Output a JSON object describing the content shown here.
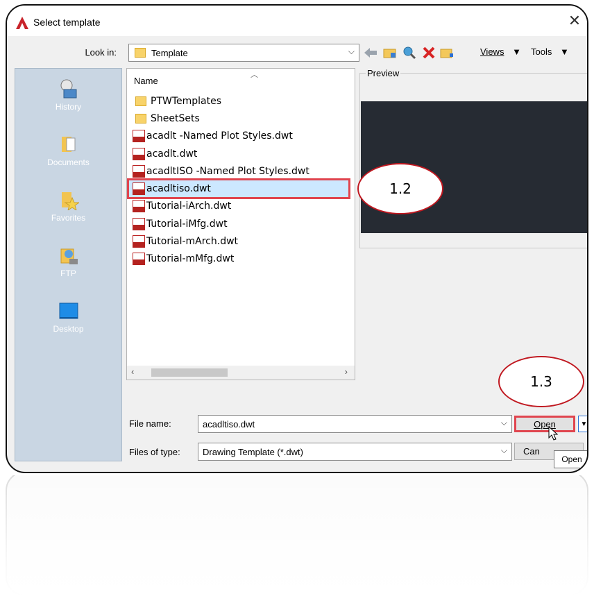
{
  "window": {
    "title": "Select template"
  },
  "toolbar": {
    "look_in_label": "Look in:",
    "look_in_value": "Template",
    "views_label": "Views",
    "tools_label": "Tools"
  },
  "places": [
    {
      "label": "History",
      "icon": "history-icon"
    },
    {
      "label": "Documents",
      "icon": "documents-icon"
    },
    {
      "label": "Favorites",
      "icon": "favorites-icon"
    },
    {
      "label": "FTP",
      "icon": "ftp-icon"
    },
    {
      "label": "Desktop",
      "icon": "desktop-icon"
    }
  ],
  "file_list": {
    "column_header": "Name",
    "items": [
      {
        "name": "PTWTemplates",
        "type": "folder"
      },
      {
        "name": "SheetSets",
        "type": "folder"
      },
      {
        "name": "acadlt -Named Plot Styles.dwt",
        "type": "dwt"
      },
      {
        "name": "acadlt.dwt",
        "type": "dwt"
      },
      {
        "name": "acadltISO -Named Plot Styles.dwt",
        "type": "dwt"
      },
      {
        "name": "acadltiso.dwt",
        "type": "dwt",
        "selected": true
      },
      {
        "name": "Tutorial-iArch.dwt",
        "type": "dwt"
      },
      {
        "name": "Tutorial-iMfg.dwt",
        "type": "dwt"
      },
      {
        "name": "Tutorial-mArch.dwt",
        "type": "dwt"
      },
      {
        "name": "Tutorial-mMfg.dwt",
        "type": "dwt"
      }
    ]
  },
  "preview": {
    "label": "Preview"
  },
  "form": {
    "file_name_label": "File name:",
    "file_name_value": "acadltiso.dwt",
    "files_of_type_label": "Files of type:",
    "files_of_type_value": "Drawing Template (*.dwt)",
    "open_label": "Open",
    "cancel_label": "Can",
    "tooltip": "Open"
  },
  "callouts": {
    "step_a": "1.2",
    "step_b": "1.3"
  },
  "colors": {
    "highlight": "#e0454f",
    "callout": "#c01820",
    "places_bg": "#c9d6e3",
    "preview_bg": "#262b33"
  }
}
